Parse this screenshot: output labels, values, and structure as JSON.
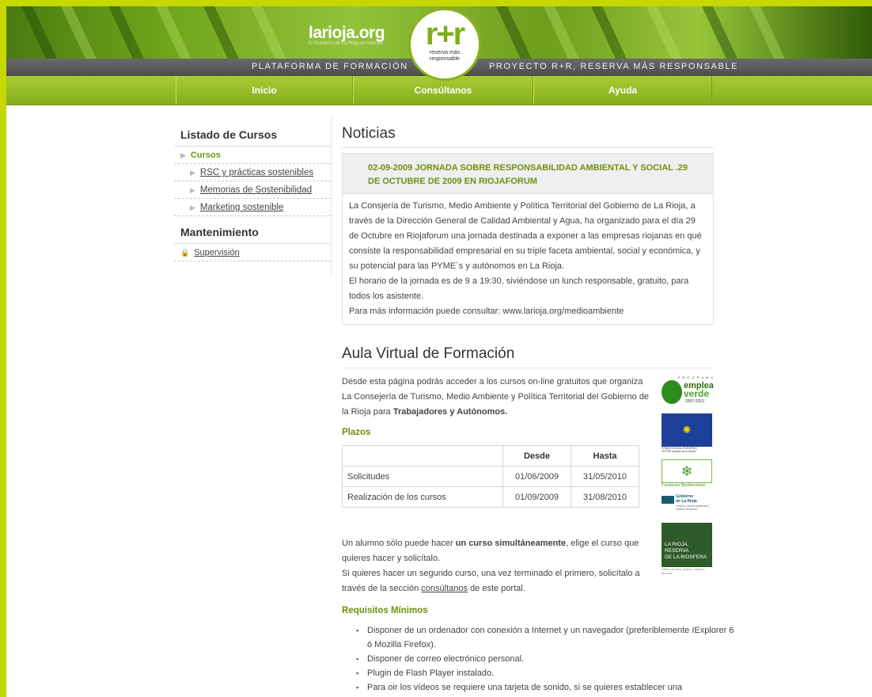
{
  "header": {
    "logo_left_name": "larioja.org",
    "logo_left_tagline": "El Gobierno de La Rioja en Internet",
    "logo_center": "r+r",
    "logo_center_caption_1": "reserva más",
    "logo_center_caption_2": "responsable",
    "strip_left": "PLATAFORMA DE FORMACIÓN",
    "strip_right": "PROYECTO R+R, RESERVA MÁS RESPONSABLE",
    "nav": [
      "Inicio",
      "Consúltanos",
      "Ayuda"
    ]
  },
  "sidebar": {
    "heading_courses": "Listado de Cursos",
    "cursos_label": "Cursos",
    "course_links": [
      "RSC y prácticas sostenibles",
      "Memorias de Sostenibilidad",
      "Marketing sostenible"
    ],
    "heading_maint": "Mantenimiento",
    "maint_link": "Supervisión"
  },
  "news": {
    "section_title": "Noticias",
    "headline": "02-09-2009 JORNADA SOBRE RESPONSABILIDAD AMBIENTAL Y SOCIAL .29 DE OCTUBRE DE 2009 EN RIOJAFORUM",
    "body_1": "La Consjería de Turismo, Medio Ambiente y Política Territorial del Gobierno de La Rioja, a través de la Dirección General de Calidad Ambiental y Agua, ha organizado para el día 29 de Octubre en Riojaforum una jornada destinada a exponer a las empresas riojanas en qué consiste la responsabilidad empresarial en su triple faceta ambiental, social y económica, y su potencial para las PYME´s y autónomos en La Rioja.",
    "body_2": "El horario de la jornada es de 9 a 19:30, siviéndose un lunch responsable, gratuito, para todos los asistente.",
    "body_3": "Para más información puede consultar: www.larioja.org/medioambiente"
  },
  "aula": {
    "section_title": "Aula Virtual de Formación",
    "intro_text": "Desde esta página podrás acceder a los cursos on-line gratuitos que organiza La Consejería de Turismo, Medio Ambiente y Política Territorial del Gobierno de la Rioja para ",
    "intro_bold": "Trabajadores y Autónomos.",
    "plazos_title": "Plazos",
    "table": {
      "headers": [
        "",
        "Desde",
        "Hasta"
      ],
      "rows": [
        [
          "Solicitudes",
          "01/06/2009",
          "31/05/2010"
        ],
        [
          "Realización de los cursos",
          "01/09/2009",
          "31/08/2010"
        ]
      ]
    },
    "note_1a": "Un alumno sólo puede hacer ",
    "note_1b": "un curso simultáneamente",
    "note_1c": ", elige el curso que quieres hacer y solicítalo.",
    "note_2a": "Si quieres hacer un segundo curso, una vez terminado el primero, solicítalo a través de la sección ",
    "note_2_link": "consúltanos",
    "note_2b": " de este portal.",
    "req_title": "Requisitos Mínimos",
    "requirements": [
      "Disponer de un ordenador con conexión a Internet y un navegador (preferiblemente IExplorer 6 ó Mozilla Firefox).",
      "Disponer de correo electrónico personal.",
      "Plugin de Flash Player instalado.",
      "Para oir los vídeos se requiere una tarjeta de sonido, si se quieres establecer una"
    ]
  },
  "logos": {
    "emplea_top": "P R O G R A M A",
    "emplea_1": "emplea",
    "emplea_2": "verde",
    "emplea_years": "2007-2013",
    "fse_1": "FONDO SOCIAL EUROPEO",
    "fse_2": "\"El FSE invierte en tu futuro\"",
    "biodiv": "Fundación Biodiversidad",
    "gob_1": "Gobierno",
    "gob_2": "de La Rioja",
    "gob_3": "Turismo, Medio Ambiente y Política Territorial",
    "bios_1": "LA RIOJA,",
    "bios_2": "RESERVA",
    "bios_3": "DE LA BIOSFERA",
    "bios_4": "valles del leza, jubera, cidacos, alhama"
  }
}
